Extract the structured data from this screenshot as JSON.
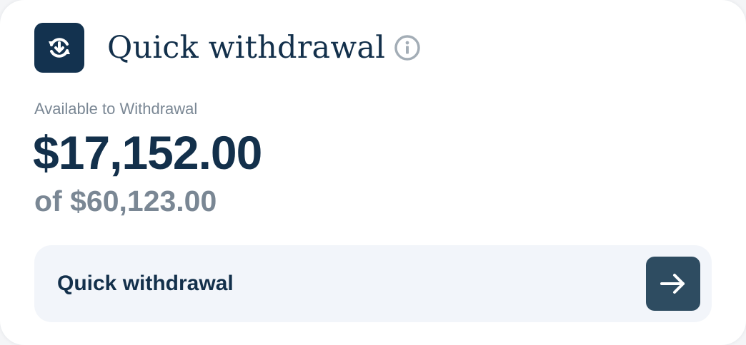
{
  "card": {
    "title": "Quick withdrawal",
    "icon": "withdraw-refresh-icon",
    "info_icon": "info-icon"
  },
  "balance": {
    "label": "Available to Withdrawal",
    "available": "$17,152.00",
    "total": "of $60,123.00"
  },
  "action": {
    "label": "Quick withdrawal",
    "icon": "arrow-right-icon"
  },
  "colors": {
    "primary": "#13304b",
    "muted": "#7a8794",
    "action_bg": "#f2f5fa",
    "arrow_button": "#2e4c61",
    "icon_tile": "#13324f"
  }
}
